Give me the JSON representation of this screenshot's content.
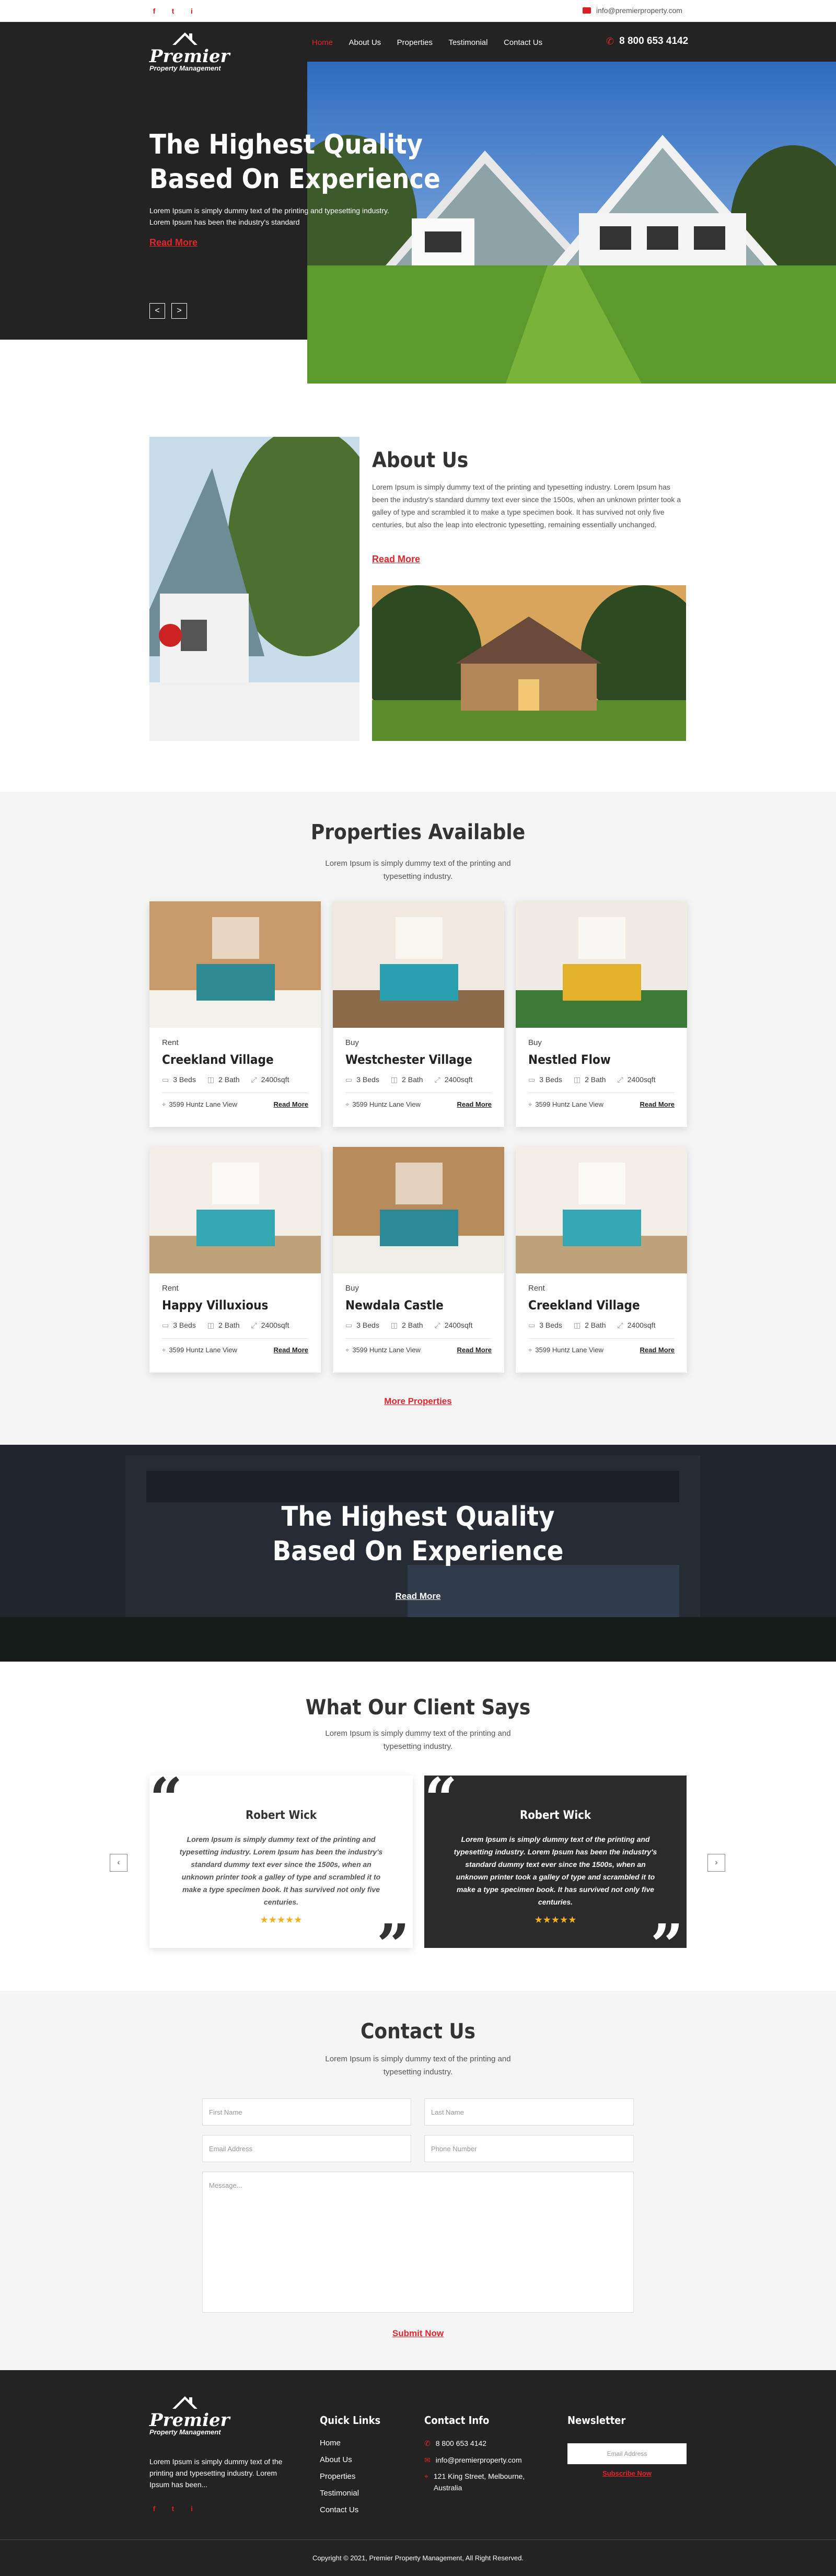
{
  "topbar": {
    "social": [
      "f",
      "t",
      "i"
    ],
    "email": "info@premierproperty.com"
  },
  "brand": {
    "logo_line1": "Premier",
    "logo_line2": "Property Management"
  },
  "nav": {
    "items": [
      "Home",
      "About Us",
      "Properties",
      "Testimonial",
      "Contact Us"
    ],
    "phone": "8 800 653 4142"
  },
  "hero": {
    "title_line1": "The Highest Quality",
    "title_line2": "Based On Experience",
    "text": "Lorem Ipsum is simply dummy text of the printing and typesetting industry. Lorem Ipsum has been the industry's standard",
    "cta": "Read More",
    "prev": "<",
    "next": ">"
  },
  "about": {
    "title": "About Us",
    "text": "Lorem Ipsum is simply dummy text of the printing and typesetting industry. Lorem Ipsum has been the industry's standard dummy text ever since the 1500s, when an unknown printer took a galley of type and scrambled it to make a type specimen book. It has survived not only five centuries, but also the leap into electronic typesetting, remaining essentially unchanged.",
    "cta": "Read More"
  },
  "properties": {
    "title": "Properties Available",
    "subtitle": "Lorem Ipsum is simply dummy text of the printing and typesetting industry.",
    "more": "More Properties",
    "cards": [
      {
        "tag": "Rent",
        "name": "Creekland Village",
        "beds": "3 Beds",
        "bath": "2 Bath",
        "area": "2400sqft",
        "address": "3599 Huntz Lane View",
        "link": "Read More"
      },
      {
        "tag": "Buy",
        "name": "Westchester Village",
        "beds": "3 Beds",
        "bath": "2 Bath",
        "area": "2400sqft",
        "address": "3599 Huntz Lane View",
        "link": "Read More"
      },
      {
        "tag": "Buy",
        "name": "Nestled Flow",
        "beds": "3 Beds",
        "bath": "2 Bath",
        "area": "2400sqft",
        "address": "3599 Huntz Lane View",
        "link": "Read More"
      },
      {
        "tag": "Rent",
        "name": "Happy Villuxious",
        "beds": "3 Beds",
        "bath": "2 Bath",
        "area": "2400sqft",
        "address": "3599 Huntz Lane View",
        "link": "Read More"
      },
      {
        "tag": "Buy",
        "name": "Newdala Castle",
        "beds": "3 Beds",
        "bath": "2 Bath",
        "area": "2400sqft",
        "address": "3599 Huntz Lane View",
        "link": "Read More"
      },
      {
        "tag": "Rent",
        "name": "Creekland Village",
        "beds": "3 Beds",
        "bath": "2 Bath",
        "area": "2400sqft",
        "address": "3599 Huntz Lane View",
        "link": "Read More"
      }
    ]
  },
  "banner": {
    "title_line1": "The Highest Quality",
    "title_line2": "Based On Experience",
    "cta": "Read More"
  },
  "testimonials": {
    "title": "What Our Client Says",
    "subtitle": "Lorem Ipsum is simply dummy text of the printing and typesetting industry.",
    "items": [
      {
        "name": "Robert Wick",
        "text": "Lorem Ipsum is simply dummy text of the printing and typesetting industry. Lorem Ipsum has been the industry's standard dummy text ever since the 1500s, when an unknown printer took a galley of type and scrambled it to make a type specimen book. It has survived not only five centuries.",
        "stars": "★★★★★"
      },
      {
        "name": "Robert Wick",
        "text": "Lorem Ipsum is simply dummy text of the printing and typesetting industry. Lorem Ipsum has been the industry's standard dummy text ever since the 1500s, when an unknown printer took a galley of type and scrambled it to make a type specimen book. It has survived not only five centuries.",
        "stars": "★★★★★"
      }
    ]
  },
  "contact": {
    "title": "Contact Us",
    "subtitle": "Lorem Ipsum is simply dummy text of the printing and typesetting industry.",
    "first_name": "First Name",
    "last_name": "Last Name",
    "email": "Email Address",
    "phone": "Phone Number",
    "message": "Message...",
    "submit": "Submit Now"
  },
  "footer": {
    "about": "Lorem Ipsum is simply dummy text of the printing and typesetting industry. Lorem Ipsum has been...",
    "quick_title": "Quick Links",
    "quick": [
      "Home",
      "About Us",
      "Properties",
      "Testimonial",
      "Contact Us"
    ],
    "info_title": "Contact Info",
    "phone": "8 800 653 4142",
    "email": "info@premierproperty.com",
    "address": "121 King Street, Melbourne, Australia",
    "news_title": "Newsletter",
    "news_placeholder": "Email Address",
    "subscribe": "Subscribe Now",
    "copyright": "Copyright © 2021, Premier Property Management, All Right Reserved."
  },
  "colors": {
    "accent": "#e0252b",
    "dark": "#232323",
    "light_bg": "#f5f5f5",
    "star": "#f2b01e"
  }
}
